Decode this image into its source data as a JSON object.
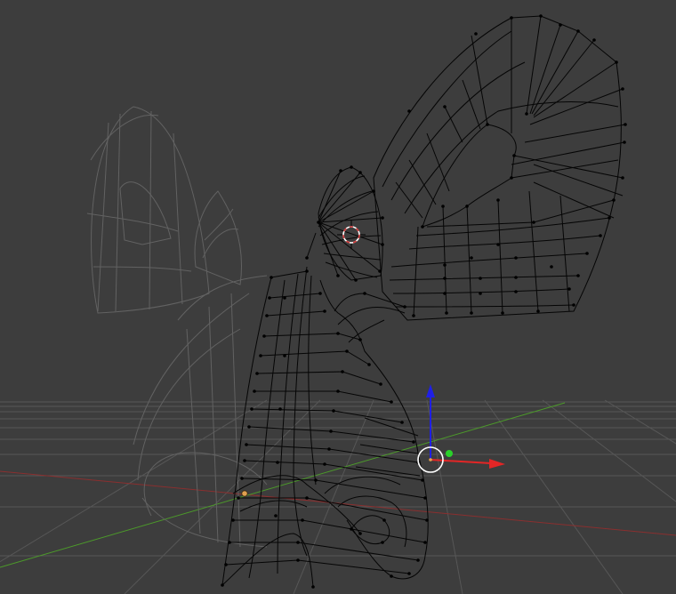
{
  "viewport": {
    "background": "#3d3d3d",
    "grid_color": "#575757",
    "x_axis_color": "#8a2f2f",
    "y_axis_color": "#4c9a2a"
  },
  "mesh": {
    "active_wire_color": "#050505",
    "ghost_wire_color": "#626262",
    "vertex_color": "#000000"
  },
  "gizmo": {
    "x_color": "#e32626",
    "y_color": "#2ad12a",
    "z_color": "#1f1fe6",
    "ring_color": "#ffffff",
    "origin_color": "#e0a050"
  },
  "cursor": {
    "outer_color": "#ffffff",
    "inner_color": "#d33a3a"
  }
}
